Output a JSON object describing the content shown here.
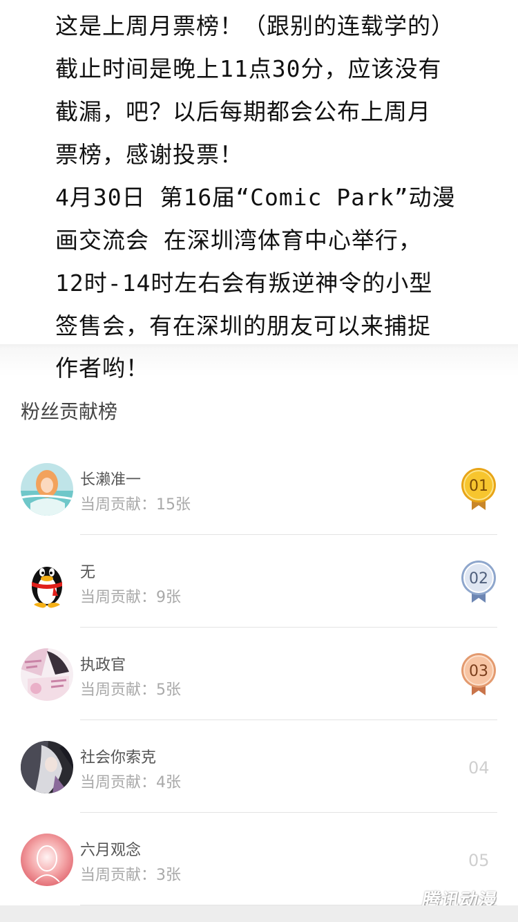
{
  "post": {
    "lines": [
      "这是上周月票榜！（跟别的连载学的）",
      "截止时间是晚上11点30分，应该没有",
      "截漏，吧？以后每期都会公布上周月",
      "票榜，感谢投票！",
      "4月30日 第16届“Comic Park”动漫",
      "画交流会 在深圳湾体育中心举行，",
      "12时-14时左右会有叛逆神令的小型",
      "签售会，有在深圳的朋友可以来捕捉",
      "作者哟！"
    ]
  },
  "fan_board": {
    "title": "粉丝贡献榜",
    "contribution_label": "当周贡献：",
    "fans": [
      {
        "name": "长濑准一",
        "contribution": "15张",
        "rank": "01",
        "avatar": "anime-girl-avatar"
      },
      {
        "name": "无",
        "contribution": "9张",
        "rank": "02",
        "avatar": "qq-penguin-avatar"
      },
      {
        "name": "执政官",
        "contribution": "5张",
        "rank": "03",
        "avatar": "manga-collage-avatar"
      },
      {
        "name": "社会你索克",
        "contribution": "4张",
        "rank": "04",
        "avatar": "dark-anime-avatar"
      },
      {
        "name": "六月观念",
        "contribution": "3张",
        "rank": "05",
        "avatar": "pink-glow-avatar"
      }
    ]
  },
  "colors": {
    "gold": "#f2b51c",
    "silver": "#8ea6cc",
    "bronze": "#e39a6f",
    "text_main": "#111111",
    "text_muted": "#a9a9a9"
  },
  "watermark": "腾讯动漫"
}
